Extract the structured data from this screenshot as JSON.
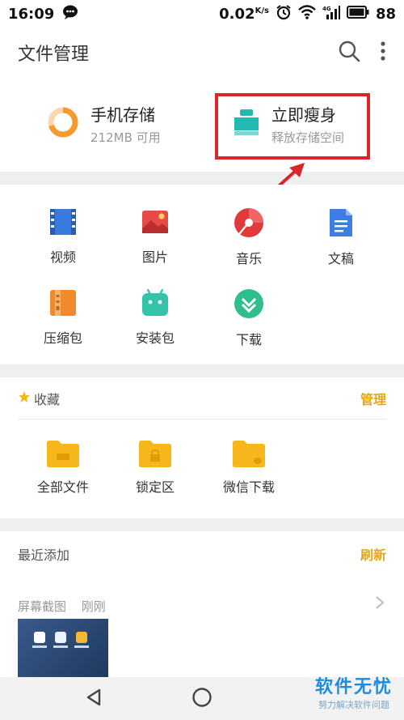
{
  "status_bar": {
    "time": "16:09",
    "speed": "0.02",
    "speed_unit": "K/s",
    "signal_label": "4G",
    "battery": "88"
  },
  "app_bar": {
    "title": "文件管理",
    "search_icon": "search-icon",
    "more_icon": "more-vertical-icon"
  },
  "storage": {
    "phone": {
      "title": "手机存储",
      "subtitle": "212MB 可用"
    },
    "slim": {
      "title": "立即瘦身",
      "subtitle": "释放存储空间"
    }
  },
  "categories": [
    {
      "label": "视频",
      "icon": "video-icon",
      "color": "#3a7be0"
    },
    {
      "label": "图片",
      "icon": "image-icon",
      "color": "#e84a4a"
    },
    {
      "label": "音乐",
      "icon": "music-icon",
      "color": "#e03a3a"
    },
    {
      "label": "文稿",
      "icon": "document-icon",
      "color": "#3d7ee6"
    },
    {
      "label": "压缩包",
      "icon": "archive-icon",
      "color": "#f08a2a"
    },
    {
      "label": "安装包",
      "icon": "android-icon",
      "color": "#34c4a8"
    },
    {
      "label": "下载",
      "icon": "download-icon",
      "color": "#2fbf8e"
    }
  ],
  "favorites": {
    "title": "收藏",
    "action": "管理",
    "folders": [
      {
        "label": "全部文件",
        "icon": "folder-icon"
      },
      {
        "label": "锁定区",
        "icon": "locked-folder-icon"
      },
      {
        "label": "微信下载",
        "icon": "wechat-folder-icon"
      }
    ]
  },
  "recent": {
    "title": "最近添加",
    "action": "刷新",
    "group_name": "屏幕截图",
    "group_time": "刚刚"
  },
  "watermark": {
    "main": "软件无忧",
    "sub": "努力解决软件问题"
  },
  "colors": {
    "accent": "#e3a814",
    "highlight": "#d9262b"
  }
}
